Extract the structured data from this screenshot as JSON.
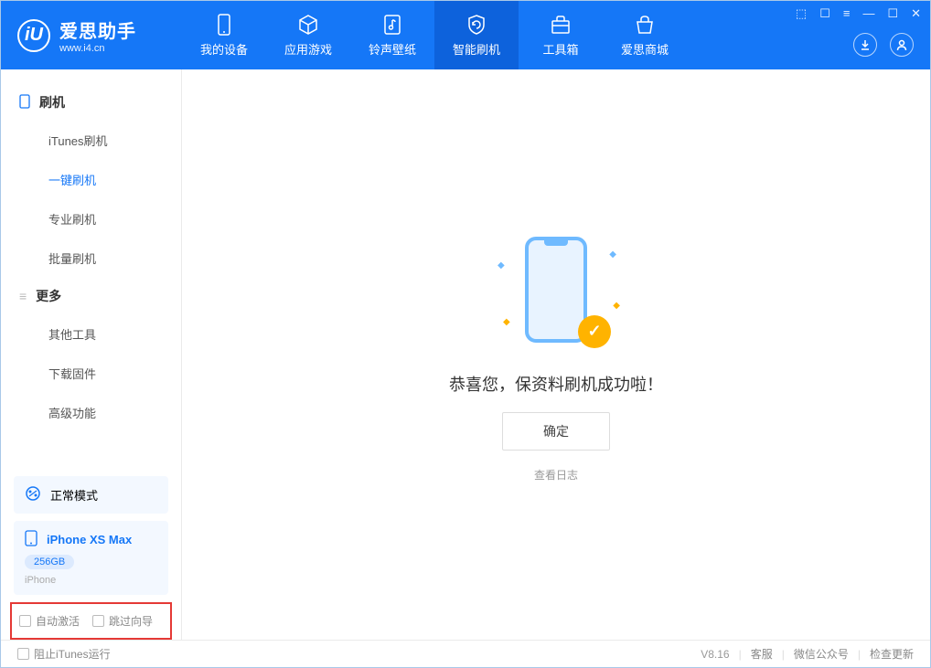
{
  "app": {
    "logo_letter": "iU",
    "title": "爱思助手",
    "url": "www.i4.cn"
  },
  "nav": {
    "tabs": [
      {
        "label": "我的设备"
      },
      {
        "label": "应用游戏"
      },
      {
        "label": "铃声壁纸"
      },
      {
        "label": "智能刷机"
      },
      {
        "label": "工具箱"
      },
      {
        "label": "爱思商城"
      }
    ]
  },
  "sidebar": {
    "section1_title": "刷机",
    "items1": [
      {
        "label": "iTunes刷机"
      },
      {
        "label": "一键刷机"
      },
      {
        "label": "专业刷机"
      },
      {
        "label": "批量刷机"
      }
    ],
    "section2_title": "更多",
    "items2": [
      {
        "label": "其他工具"
      },
      {
        "label": "下载固件"
      },
      {
        "label": "高级功能"
      }
    ],
    "mode_label": "正常模式",
    "device": {
      "name": "iPhone XS Max",
      "storage": "256GB",
      "type": "iPhone"
    },
    "checkbox1": "自动激活",
    "checkbox2": "跳过向导"
  },
  "main": {
    "success_message": "恭喜您，保资料刷机成功啦！",
    "ok_button": "确定",
    "log_link": "查看日志"
  },
  "footer": {
    "block_itunes": "阻止iTunes运行",
    "version": "V8.16",
    "link1": "客服",
    "link2": "微信公众号",
    "link3": "检查更新"
  }
}
